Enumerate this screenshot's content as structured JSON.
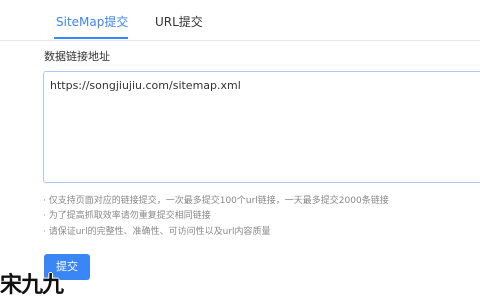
{
  "tabs": [
    {
      "label": "SiteMap提交",
      "active": true
    },
    {
      "label": "URL提交",
      "active": false
    }
  ],
  "form": {
    "field_label": "数据链接地址",
    "value": "https://songjiujiu.com/sitemap.xml"
  },
  "hints": [
    "· 仅支持页面对应的链接提交，一次最多提交100个url链接，一天最多提交2000条链接",
    "· 为了提高抓取效率请勿重复提交相同链接",
    "· 请保证url的完整性、准确性、可访问性以及url内容质量"
  ],
  "submit_label": "提交",
  "watermark": "宋九九",
  "colors": {
    "accent": "#3b86f7",
    "hint_text": "#888888",
    "input_border": "#a9c9f7"
  }
}
